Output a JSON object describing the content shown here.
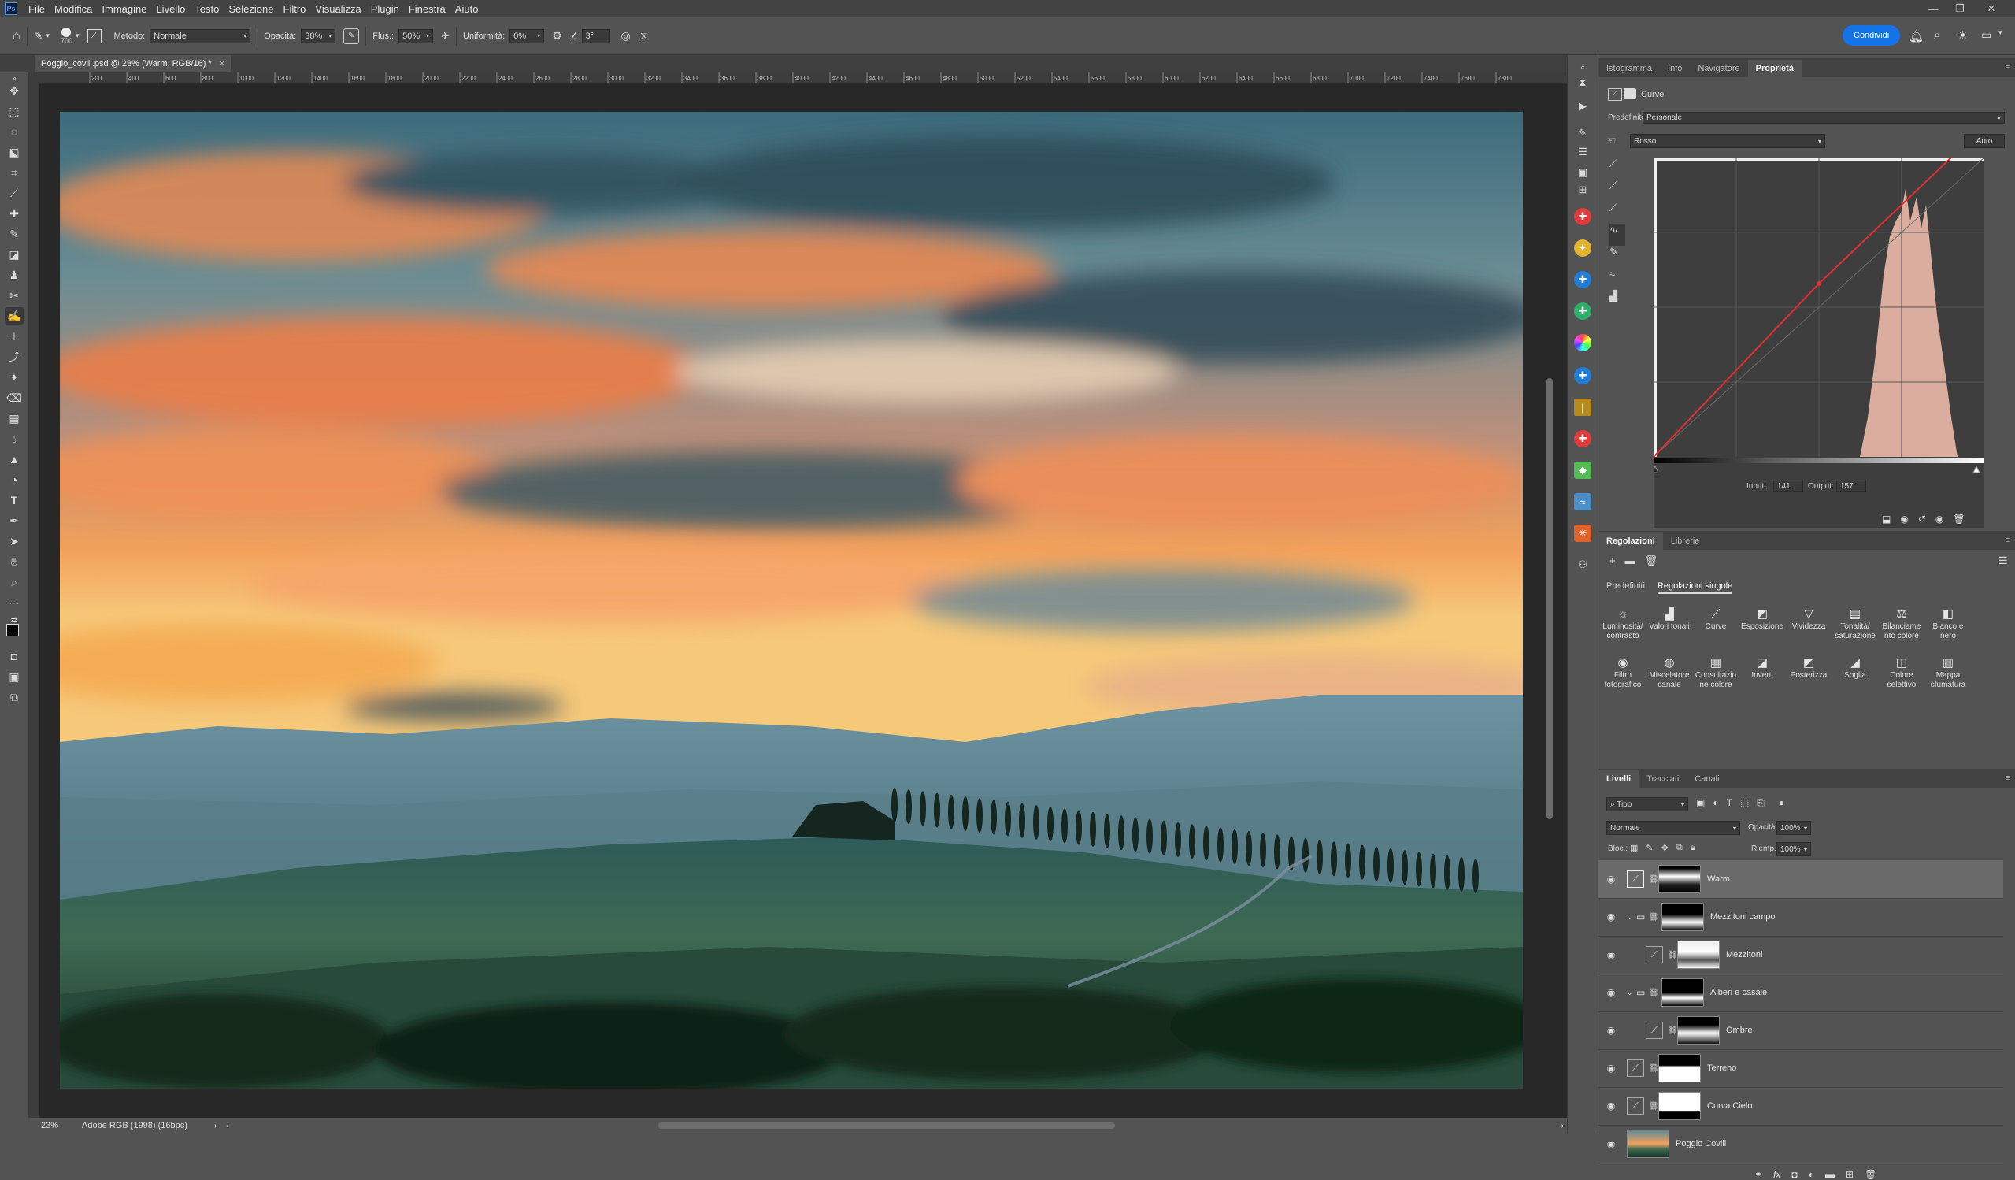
{
  "menubar": {
    "logo": "Ps",
    "items": [
      "File",
      "Modifica",
      "Immagine",
      "Livello",
      "Testo",
      "Selezione",
      "Filtro",
      "Visualizza",
      "Plugin",
      "Finestra",
      "Aiuto"
    ]
  },
  "options": {
    "brush_size": "700",
    "mode_label": "Metodo:",
    "mode_value": "Normale",
    "opacity_label": "Opacità:",
    "opacity_value": "38%",
    "flow_label": "Flus.:",
    "flow_value": "50%",
    "smoothing_label": "Uniformità:",
    "smoothing_value": "0%",
    "angle_value": "3°",
    "share_label": "Condividi"
  },
  "document": {
    "tab_title": "Poggio_covili.psd @ 23% (Warm, RGB/16) *",
    "close": "×"
  },
  "ruler": {
    "ticks": [
      "200",
      "400",
      "600",
      "800",
      "1000",
      "1200",
      "1400",
      "1600",
      "1800",
      "2000",
      "2200",
      "2400",
      "2600",
      "2800",
      "3000",
      "3200",
      "3400",
      "3600",
      "3800",
      "4000",
      "4200",
      "4400",
      "4600",
      "4800",
      "5000",
      "5200",
      "5400",
      "5600",
      "5800",
      "6000",
      "6200",
      "6400",
      "6600",
      "6800",
      "7000",
      "7200",
      "7400",
      "7600",
      "7800"
    ]
  },
  "status": {
    "zoom": "23%",
    "profile": "Adobe RGB (1998) (16bpc)"
  },
  "properties_panel": {
    "tabs": [
      "Istogramma",
      "Info",
      "Navigatore",
      "Proprietà"
    ],
    "active_tab": "Proprietà",
    "title": "Curve",
    "preset_label": "Predefinito:",
    "preset_value": "Personale",
    "channel_value": "Rosso",
    "auto_label": "Auto",
    "input_label": "Input:",
    "input_value": "141",
    "output_label": "Output:",
    "output_value": "157",
    "curve_color": "#e03030"
  },
  "adjustments_panel": {
    "tabs": [
      "Regolazioni",
      "Librerie"
    ],
    "subtabs": [
      "Predefiniti",
      "Regolazioni singole"
    ],
    "items": [
      {
        "icon": "☼",
        "label": "Luminosità/ contrasto"
      },
      {
        "icon": "▟",
        "label": "Valori tonali"
      },
      {
        "icon": "⟋",
        "label": "Curve"
      },
      {
        "icon": "◩",
        "label": "Esposizione"
      },
      {
        "icon": "▽",
        "label": "Vividezza"
      },
      {
        "icon": "▤",
        "label": "Tonalità/ saturazione"
      },
      {
        "icon": "⚖",
        "label": "Bilanciame nto colore"
      },
      {
        "icon": "◧",
        "label": "Bianco e nero"
      },
      {
        "icon": "◉",
        "label": "Filtro fotografico"
      },
      {
        "icon": "◍",
        "label": "Miscelatore canale"
      },
      {
        "icon": "▦",
        "label": "Consultazio ne colore"
      },
      {
        "icon": "◪",
        "label": "Inverti"
      },
      {
        "icon": "◩",
        "label": "Posterizza"
      },
      {
        "icon": "◢",
        "label": "Soglia"
      },
      {
        "icon": "◫",
        "label": "Colore selettivo"
      },
      {
        "icon": "▥",
        "label": "Mappa sfumatura"
      }
    ]
  },
  "layers_panel": {
    "tabs": [
      "Livelli",
      "Tracciati",
      "Canali"
    ],
    "filter_value": "Tipo",
    "blend_value": "Normale",
    "opacity_label": "Opacità:",
    "opacity_value": "100%",
    "lock_label": "Bloc.:",
    "fill_label": "Riemp.:",
    "fill_value": "100%",
    "layers": [
      {
        "name": "Warm",
        "type": "curve",
        "selected": true
      },
      {
        "name": "Mezzitoni campo",
        "type": "group"
      },
      {
        "name": "Mezzitoni",
        "type": "curve-indent"
      },
      {
        "name": "Alberi e casale",
        "type": "group"
      },
      {
        "name": "Ombre",
        "type": "curve-indent"
      },
      {
        "name": "Terreno",
        "type": "curve"
      },
      {
        "name": "Curva Cielo",
        "type": "curve"
      },
      {
        "name": "Poggio Covili",
        "type": "image"
      }
    ]
  }
}
